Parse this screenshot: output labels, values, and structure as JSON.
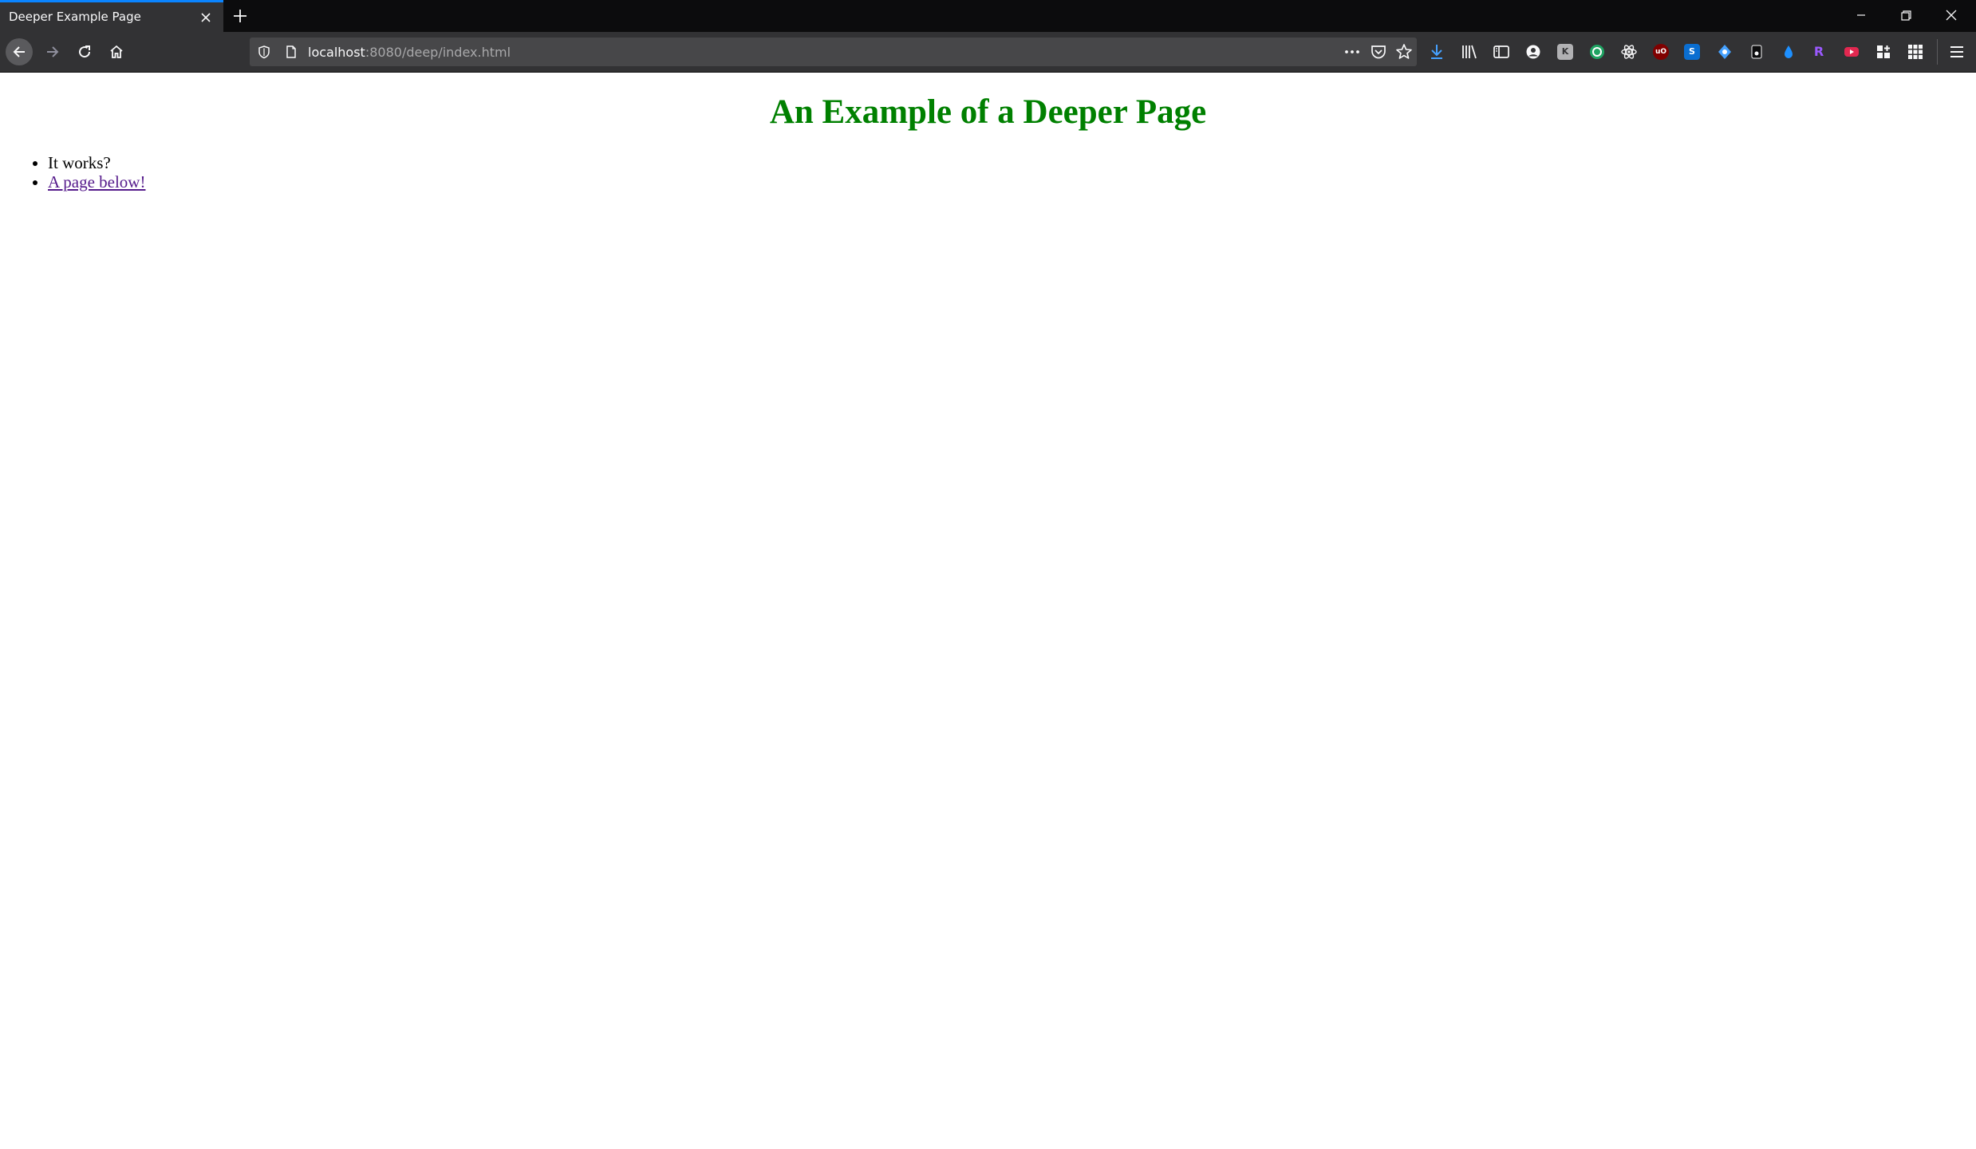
{
  "browser": {
    "tab": {
      "title": "Deeper Example Page"
    },
    "urlbar": {
      "host": "localhost",
      "rest": ":8080/deep/index.html"
    },
    "colors": {
      "tab_accent": "#0a84ff",
      "toolbar_bg": "#323234",
      "tabstrip_bg": "#0c0c0d"
    },
    "toolbar_icons": [
      "download-icon",
      "library-icon",
      "sidebar-icon",
      "account-icon",
      "extension-k-icon",
      "extension-green-icon",
      "extension-gear-icon",
      "ublock-icon",
      "extension-s-icon",
      "extension-blue-icon",
      "extension-dark-icon",
      "extension-drop-icon",
      "extension-r-icon",
      "extension-red-icon",
      "extension-grid-plus-icon",
      "apps-grid-icon",
      "menu-icon"
    ],
    "extension_badges": {
      "k": "K",
      "ublock": "uO",
      "s": "S",
      "r": "R"
    }
  },
  "page": {
    "heading": "An Example of a Deeper Page",
    "heading_color": "#008000",
    "items": [
      {
        "text": "It works?"
      },
      {
        "link_text": "A page below!",
        "link_color": "#551a8b"
      }
    ]
  }
}
